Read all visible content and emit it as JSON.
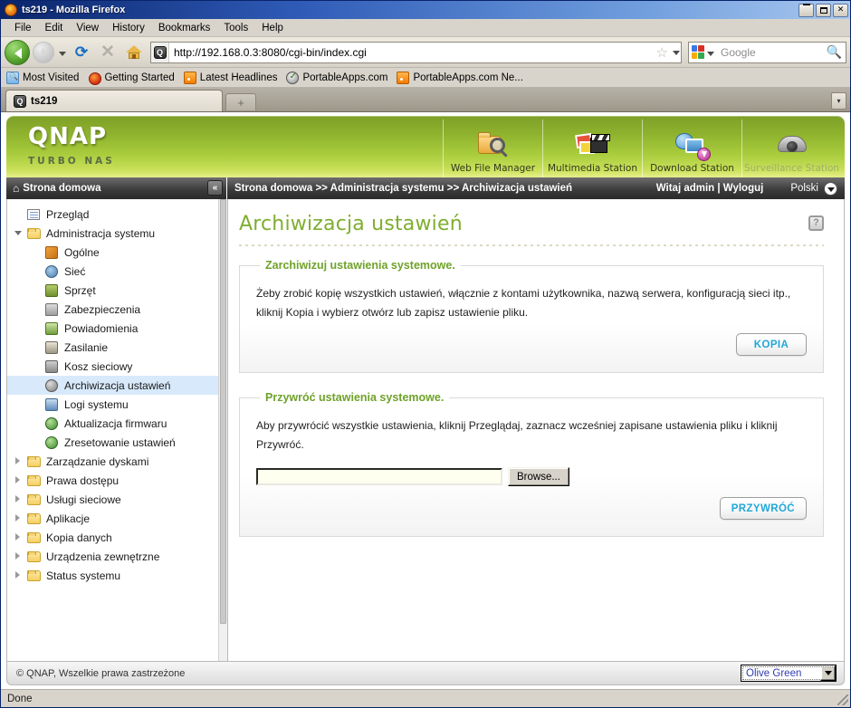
{
  "browser": {
    "title": "ts219 - Mozilla Firefox",
    "window_buttons": {
      "minimize": "_",
      "maximize": "□",
      "close": "✕"
    },
    "menus": [
      "File",
      "Edit",
      "View",
      "History",
      "Bookmarks",
      "Tools",
      "Help"
    ],
    "url": "http://192.168.0.3:8080/cgi-bin/index.cgi",
    "search_placeholder": "Google",
    "bookmarks": [
      {
        "label": "Most Visited",
        "icon": "folder-search-icon"
      },
      {
        "label": "Getting Started",
        "icon": "firefox-icon"
      },
      {
        "label": "Latest Headlines",
        "icon": "rss-icon"
      },
      {
        "label": "PortableApps.com",
        "icon": "portableapps-icon"
      },
      {
        "label": "PortableApps.com Ne...",
        "icon": "rss-icon"
      }
    ],
    "tab_label": "ts219",
    "new_tab_label": "+",
    "tab_scroll_label": "▾",
    "status_text": "Done"
  },
  "banner": {
    "logo": "QNAP",
    "tagline": "TURBO NAS",
    "apps": [
      {
        "label": "Web File Manager",
        "icon": "web-file-manager-icon",
        "disabled": false
      },
      {
        "label": "Multimedia Station",
        "icon": "multimedia-station-icon",
        "disabled": false
      },
      {
        "label": "Download Station",
        "icon": "download-station-icon",
        "disabled": false
      },
      {
        "label": "Surveillance Station",
        "icon": "surveillance-station-icon",
        "disabled": true
      }
    ]
  },
  "crumbbar": {
    "home_label": "Strona domowa",
    "collapse_label": "«",
    "breadcrumb": "Strona domowa >> Administracja systemu >> Archiwizacja ustawień",
    "user_greeting": "Witaj admin | Wyloguj",
    "language": "Polski"
  },
  "sidebar": {
    "items": [
      {
        "label": "Przegląd",
        "level": 1,
        "twisty": "none",
        "icon": "overview-icon",
        "selected": false
      },
      {
        "label": "Administracja systemu",
        "level": 1,
        "twisty": "open",
        "icon": "folder-icon",
        "selected": false
      },
      {
        "label": "Ogólne",
        "level": 2,
        "twisty": "none",
        "icon": "general-icon",
        "selected": false
      },
      {
        "label": "Sieć",
        "level": 2,
        "twisty": "none",
        "icon": "network-icon",
        "selected": false
      },
      {
        "label": "Sprzęt",
        "level": 2,
        "twisty": "none",
        "icon": "hardware-icon",
        "selected": false
      },
      {
        "label": "Zabezpieczenia",
        "level": 2,
        "twisty": "none",
        "icon": "security-lock-icon",
        "selected": false
      },
      {
        "label": "Powiadomienia",
        "level": 2,
        "twisty": "none",
        "icon": "notification-icon",
        "selected": false
      },
      {
        "label": "Zasilanie",
        "level": 2,
        "twisty": "none",
        "icon": "power-icon",
        "selected": false
      },
      {
        "label": "Kosz sieciowy",
        "level": 2,
        "twisty": "none",
        "icon": "recycle-bin-icon",
        "selected": false
      },
      {
        "label": "Archiwizacja ustawień",
        "level": 2,
        "twisty": "none",
        "icon": "backup-icon",
        "selected": true
      },
      {
        "label": "Logi systemu",
        "level": 2,
        "twisty": "none",
        "icon": "system-logs-icon",
        "selected": false
      },
      {
        "label": "Aktualizacja firmwaru",
        "level": 2,
        "twisty": "none",
        "icon": "firmware-icon",
        "selected": false
      },
      {
        "label": "Zresetowanie ustawień",
        "level": 2,
        "twisty": "none",
        "icon": "reset-icon",
        "selected": false
      },
      {
        "label": "Zarządzanie dyskami",
        "level": 1,
        "twisty": "closed",
        "icon": "folder-icon",
        "selected": false
      },
      {
        "label": "Prawa dostępu",
        "level": 1,
        "twisty": "closed",
        "icon": "folder-icon",
        "selected": false
      },
      {
        "label": "Usługi sieciowe",
        "level": 1,
        "twisty": "closed",
        "icon": "folder-icon",
        "selected": false
      },
      {
        "label": "Aplikacje",
        "level": 1,
        "twisty": "closed",
        "icon": "folder-icon",
        "selected": false
      },
      {
        "label": "Kopia danych",
        "level": 1,
        "twisty": "closed",
        "icon": "folder-icon",
        "selected": false
      },
      {
        "label": "Urządzenia zewnętrzne",
        "level": 1,
        "twisty": "closed",
        "icon": "folder-icon",
        "selected": false
      },
      {
        "label": "Status systemu",
        "level": 1,
        "twisty": "closed",
        "icon": "folder-icon",
        "selected": false
      }
    ]
  },
  "content": {
    "page_title": "Archiwizacja ustawień",
    "help_label": "?",
    "backup_panel": {
      "legend": "Zarchiwizuj ustawienia systemowe.",
      "description": "Żeby zrobić kopię wszystkich ustawień, włącznie z kontami użytkownika, nazwą serwera, konfiguracją sieci itp., kliknij Kopia i wybierz otwórz lub zapisz ustawienie pliku.",
      "button_label": "KOPIA"
    },
    "restore_panel": {
      "legend": "Przywróć ustawienia systemowe.",
      "description": "Aby przywrócić wszystkie ustawienia, kliknij Przeglądaj, zaznacz wcześniej zapisane ustawienia pliku i kliknij Przywróć.",
      "file_value": "",
      "browse_label": "Browse...",
      "button_label": "PRZYWRÓĆ"
    }
  },
  "footer": {
    "copyright": "© QNAP, Wszelkie prawa zastrzeżone",
    "theme_value": "Olive Green"
  },
  "colors": {
    "qnap_green_dark": "#7d9f28",
    "qnap_green_light": "#e6f08a",
    "title_green": "#7fae2f",
    "legend_green": "#6fa22a",
    "button_cyan": "#21a7d8",
    "selected_row": "#d8e9fb",
    "titlebar_blue": "#0a246a"
  }
}
